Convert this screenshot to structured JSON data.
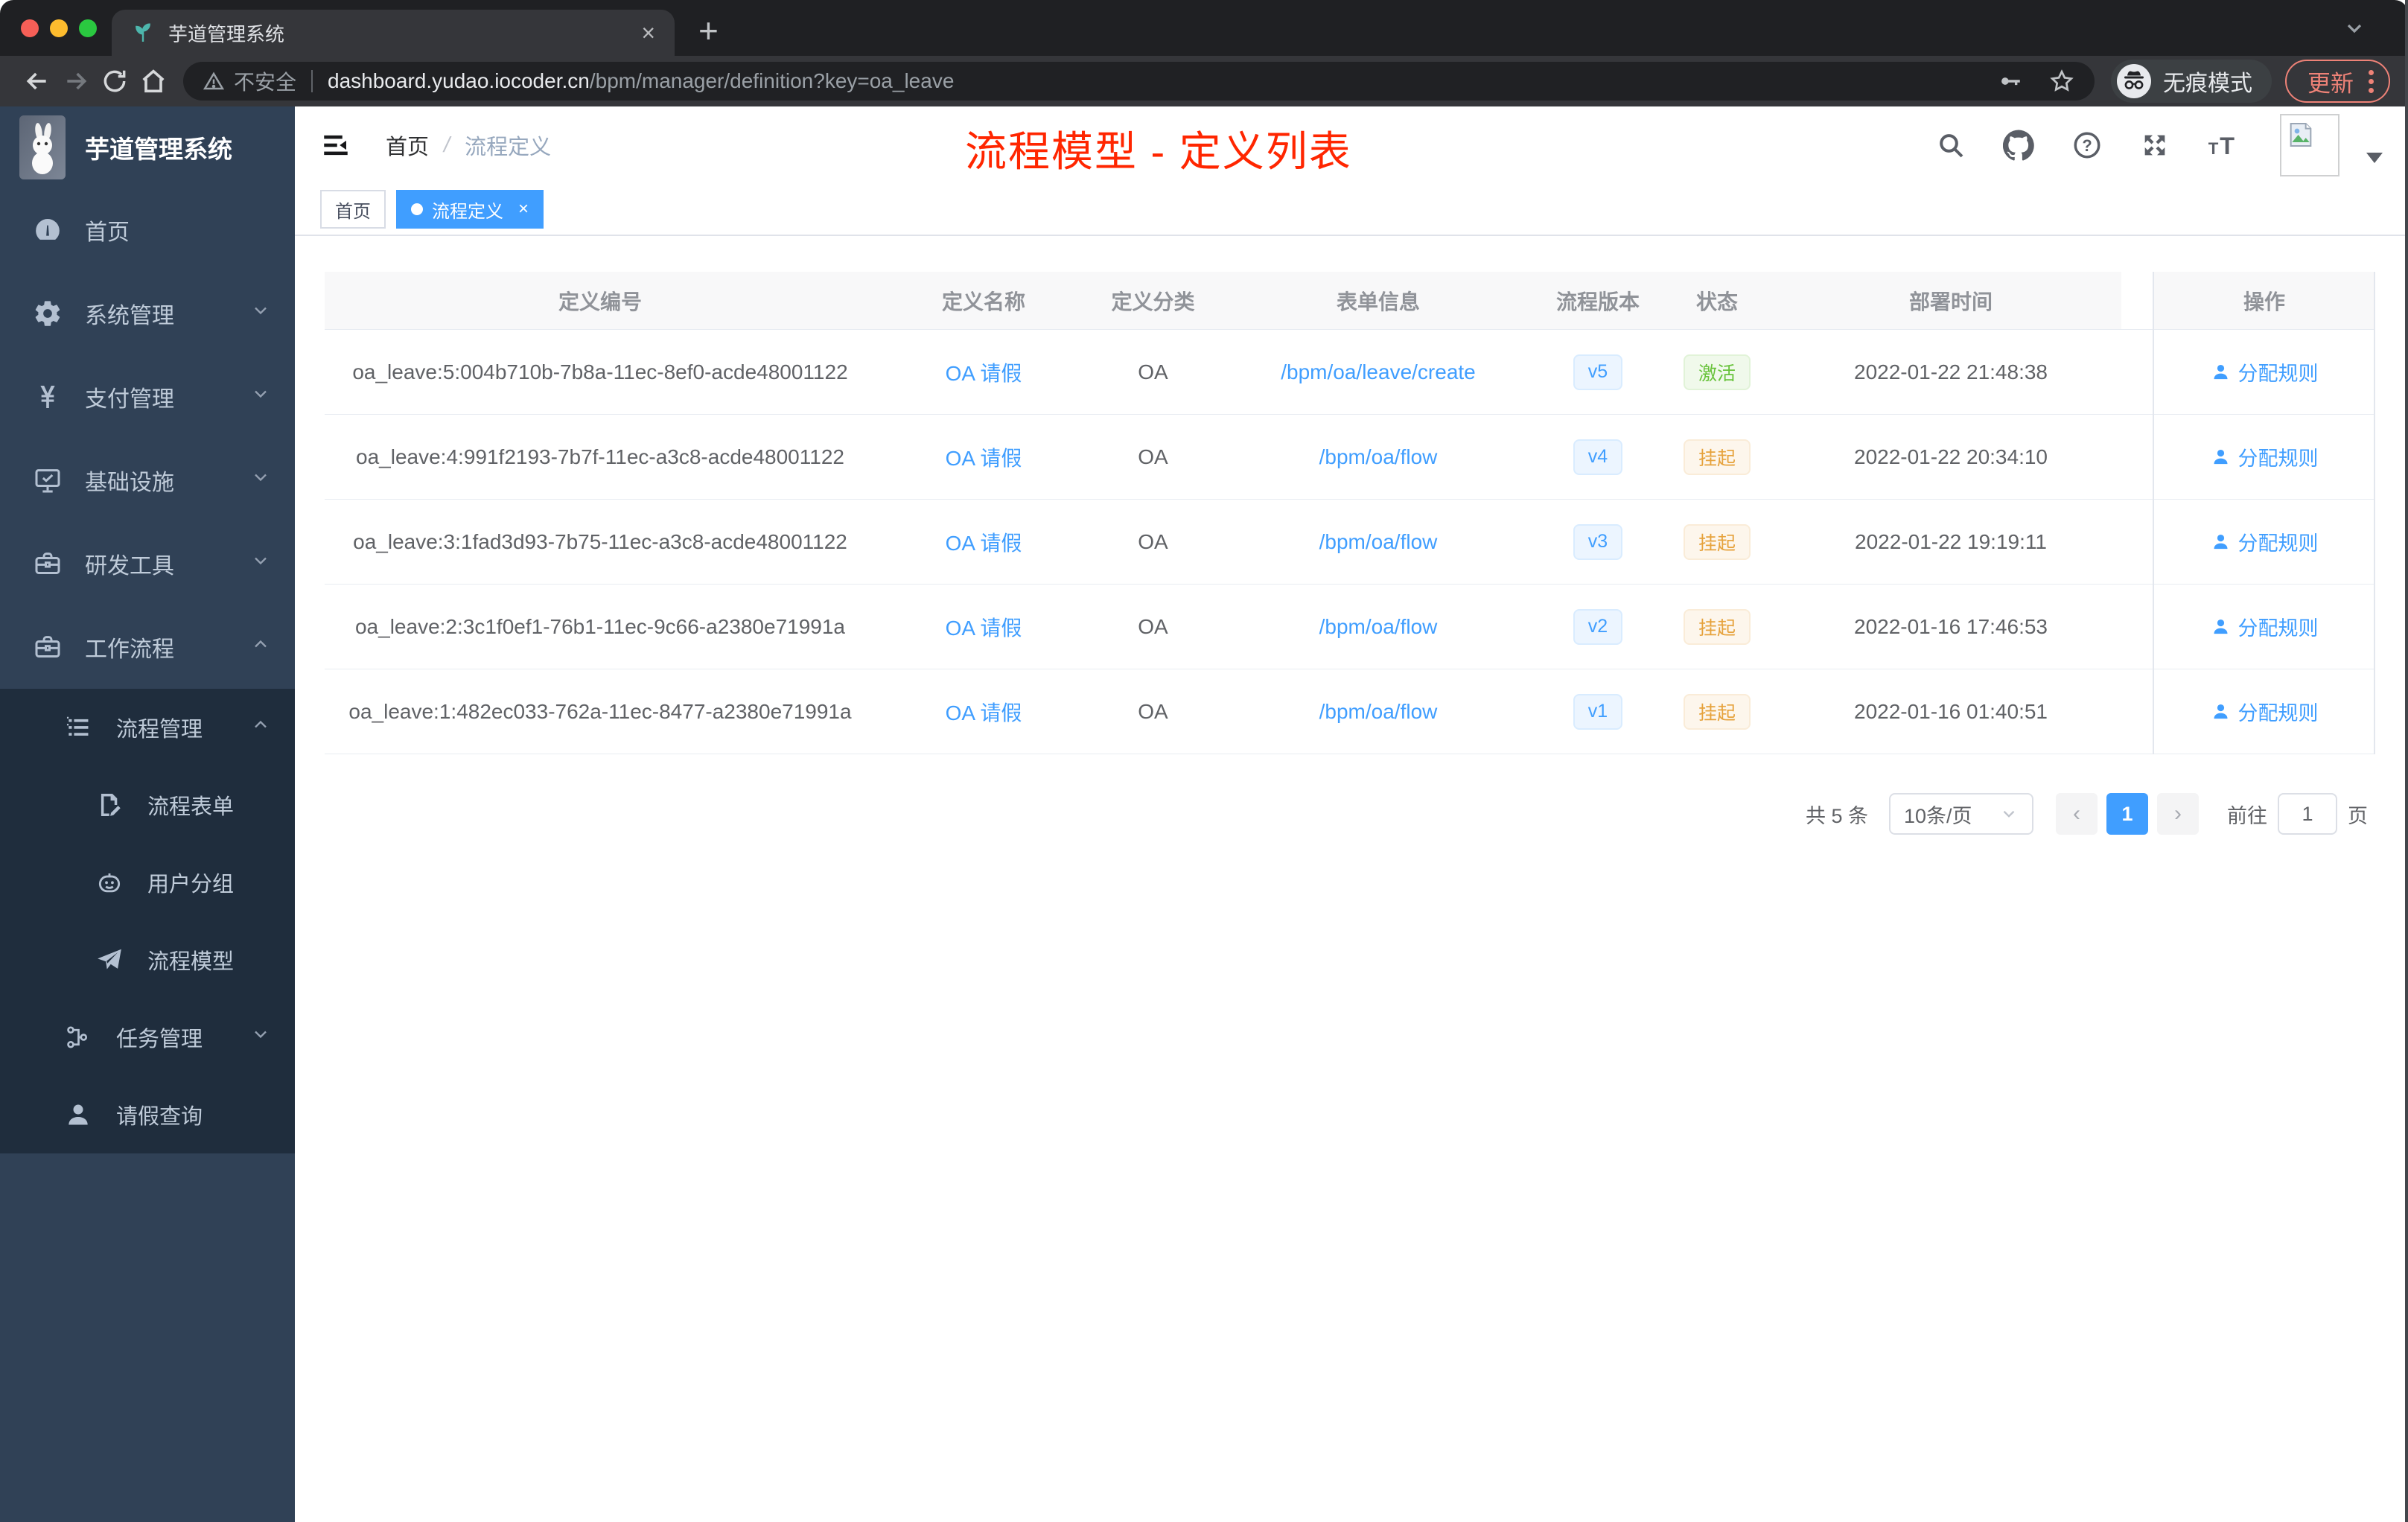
{
  "browser": {
    "tab": {
      "title": "芋道管理系统",
      "close_glyph": "×",
      "new_tab_glyph": "+"
    },
    "toolbar": {
      "security_label": "不安全",
      "url_host": "dashboard.yudao.iocoder.cn",
      "url_path": "/bpm/manager/definition?key=oa_leave",
      "incognito_label": "无痕模式",
      "update_label": "更新"
    }
  },
  "sidebar": {
    "title": "芋道管理系统",
    "menu": [
      {
        "key": "home",
        "icon": "dashboard-icon",
        "label": "首页"
      },
      {
        "key": "system",
        "icon": "gear-icon",
        "label": "系统管理",
        "expandable": true,
        "expanded": false
      },
      {
        "key": "payment",
        "icon": "yen-icon",
        "label": "支付管理",
        "expandable": true,
        "expanded": false
      },
      {
        "key": "infrastructure",
        "icon": "monitor-icon",
        "label": "基础设施",
        "expandable": true,
        "expanded": false
      },
      {
        "key": "dev-tools",
        "icon": "toolbox-icon",
        "label": "研发工具",
        "expandable": true,
        "expanded": false
      },
      {
        "key": "workflow",
        "icon": "briefcase-icon",
        "label": "工作流程",
        "expandable": true,
        "expanded": true,
        "children": [
          {
            "key": "process-mgmt",
            "icon": "list-icon",
            "label": "流程管理",
            "expandable": true,
            "expanded": true,
            "children": [
              {
                "key": "process-form",
                "icon": "form-icon",
                "label": "流程表单"
              },
              {
                "key": "user-group",
                "icon": "robot-icon",
                "label": "用户分组"
              },
              {
                "key": "process-model",
                "icon": "paper-plane-icon",
                "label": "流程模型"
              }
            ]
          },
          {
            "key": "task-mgmt",
            "icon": "tree-icon",
            "label": "任务管理",
            "expandable": true,
            "expanded": false
          },
          {
            "key": "leave-query",
            "icon": "user-icon",
            "label": "请假查询"
          }
        ]
      }
    ]
  },
  "navbar": {
    "breadcrumb": [
      "首页",
      "流程定义"
    ],
    "separator": "/"
  },
  "overlay_title": "流程模型 - 定义列表",
  "tags": [
    {
      "label": "首页",
      "active": false
    },
    {
      "label": "流程定义",
      "active": true,
      "close_glyph": "×"
    }
  ],
  "table": {
    "columns": [
      "定义编号",
      "定义名称",
      "定义分类",
      "表单信息",
      "流程版本",
      "状态",
      "部署时间",
      "操作"
    ],
    "rows": [
      {
        "id": "oa_leave:5:004b710b-7b8a-11ec-8ef0-acde48001122",
        "name": "OA 请假",
        "category": "OA",
        "form": "/bpm/oa/leave/create",
        "version": "v5",
        "status": "激活",
        "status_type": "success",
        "deployed_at": "2022-01-22 21:48:38",
        "action": "分配规则"
      },
      {
        "id": "oa_leave:4:991f2193-7b7f-11ec-a3c8-acde48001122",
        "name": "OA 请假",
        "category": "OA",
        "form": "/bpm/oa/flow",
        "version": "v4",
        "status": "挂起",
        "status_type": "warning",
        "deployed_at": "2022-01-22 20:34:10",
        "action": "分配规则"
      },
      {
        "id": "oa_leave:3:1fad3d93-7b75-11ec-a3c8-acde48001122",
        "name": "OA 请假",
        "category": "OA",
        "form": "/bpm/oa/flow",
        "version": "v3",
        "status": "挂起",
        "status_type": "warning",
        "deployed_at": "2022-01-22 19:19:11",
        "action": "分配规则"
      },
      {
        "id": "oa_leave:2:3c1f0ef1-76b1-11ec-9c66-a2380e71991a",
        "name": "OA 请假",
        "category": "OA",
        "form": "/bpm/oa/flow",
        "version": "v2",
        "status": "挂起",
        "status_type": "warning",
        "deployed_at": "2022-01-16 17:46:53",
        "action": "分配规则"
      },
      {
        "id": "oa_leave:1:482ec033-762a-11ec-8477-a2380e71991a",
        "name": "OA 请假",
        "category": "OA",
        "form": "/bpm/oa/flow",
        "version": "v1",
        "status": "挂起",
        "status_type": "warning",
        "deployed_at": "2022-01-16 01:40:51",
        "action": "分配规则"
      }
    ]
  },
  "pagination": {
    "total": "共 5 条",
    "page_size": "10条/页",
    "prev_glyph": "‹",
    "next_glyph": "›",
    "current_page": "1",
    "goto_label": "前往",
    "goto_value": "1",
    "page_unit": "页"
  },
  "colors": {
    "accent": "#409eff",
    "sidebar_bg": "#304156",
    "submenu_bg": "#1f2d3d",
    "success": "#67c23a",
    "warning": "#e6a23c",
    "annotation_red": "#ff2600",
    "table_header_bg": "#f8f8f9"
  }
}
